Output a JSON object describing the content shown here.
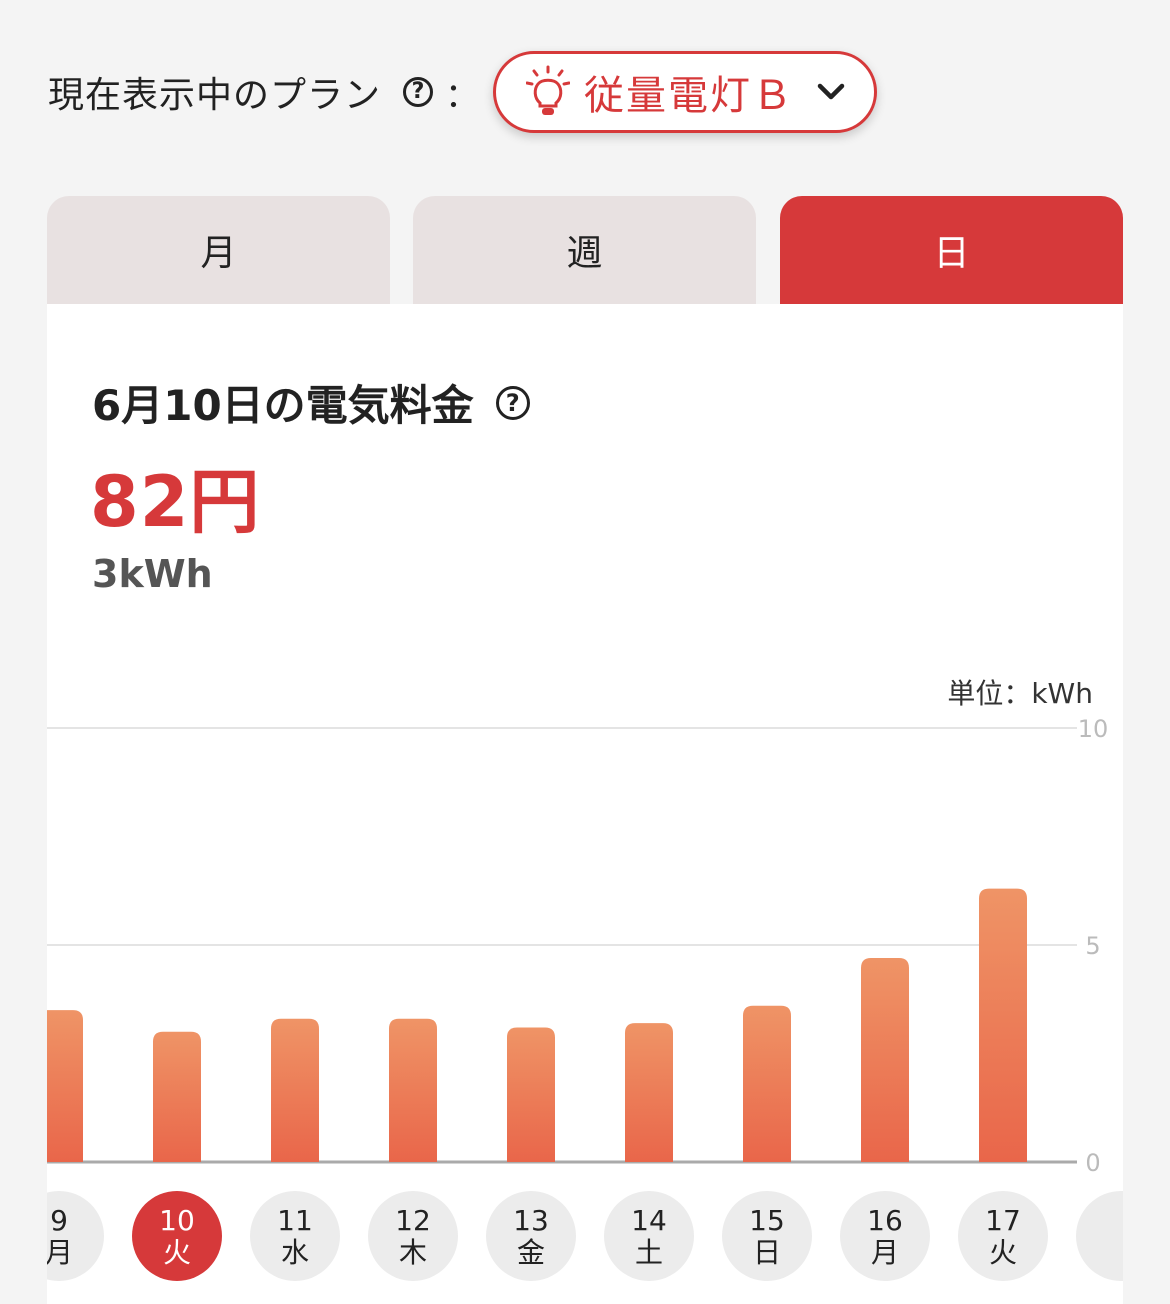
{
  "plan": {
    "label": "現在表示中のプラン",
    "help_glyph": "?",
    "colon": "：",
    "selected": "従量電灯Ｂ",
    "icon": "lightbulb-icon"
  },
  "tabs": [
    {
      "label": "月",
      "active": false
    },
    {
      "label": "週",
      "active": false
    },
    {
      "label": "日",
      "active": true
    }
  ],
  "summary": {
    "title": "6月10日の電気料金",
    "price": "82円",
    "usage": "3kWh"
  },
  "chart_unit": "単位：kWh",
  "colors": {
    "accent": "#d6393a",
    "bar_top": "#ef9466",
    "bar_bottom": "#e9664a",
    "tab_inactive": "#e8e1e1",
    "date_bubble": "#ececec"
  },
  "chart_data": {
    "type": "bar",
    "categories": [
      "9",
      "10",
      "11",
      "12",
      "13",
      "14",
      "15",
      "16",
      "17"
    ],
    "weekdays": [
      "月",
      "火",
      "水",
      "木",
      "金",
      "土",
      "日",
      "月",
      "火"
    ],
    "values": [
      3.5,
      3.0,
      3.3,
      3.3,
      3.1,
      3.2,
      3.6,
      4.7,
      6.3
    ],
    "selected_index": 1,
    "ylim": [
      0,
      10
    ],
    "yticks": [
      "0",
      "5",
      "10"
    ],
    "ylabel": "kWh",
    "grid": true
  }
}
